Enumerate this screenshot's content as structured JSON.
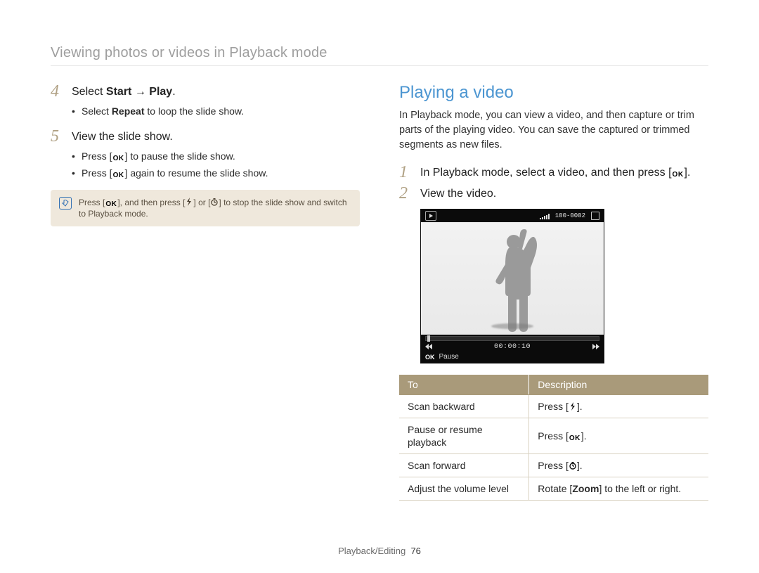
{
  "breadcrumb": "Viewing photos or videos in Playback mode",
  "page_footer": {
    "section": "Playback/Editing",
    "number": "76"
  },
  "glyphs": {
    "ok": "OK",
    "zoom": "Zoom"
  },
  "left": {
    "steps": [
      {
        "num": "4",
        "text_pre": "Select ",
        "bold1": "Start",
        "arrow": " → ",
        "bold2": "Play",
        "text_post": ".",
        "bullets": [
          {
            "pre": "Select ",
            "bold": "Repeat",
            "post": " to loop the slide show."
          }
        ]
      },
      {
        "num": "5",
        "plain": "View the slide show.",
        "bullets_ok": [
          {
            "pre": "Press [",
            "post": "] to pause the slide show."
          },
          {
            "pre": "Press [",
            "post": "] again to resume the slide show."
          }
        ]
      }
    ],
    "note": {
      "pre": "Press [",
      "mid1": "], and then press [",
      "mid2": "] or [",
      "mid3": "] to stop the slide show and switch to Playback mode."
    }
  },
  "right": {
    "title": "Playing a video",
    "intro": "In Playback mode, you can view a video, and then capture or trim parts of the playing video. You can save the captured or trimmed segments as new files.",
    "steps": [
      {
        "num": "1",
        "pre": "In Playback mode, select a video, and then press [",
        "post": "]."
      },
      {
        "num": "2",
        "plain": "View the video."
      }
    ],
    "video": {
      "file_counter": "100-0002",
      "time": "00:00:10",
      "bottom_label": "Pause"
    },
    "table": {
      "head": [
        "To",
        "Description"
      ],
      "rows": [
        {
          "to": "Scan backward",
          "desc_pre": "Press [",
          "icon": "flash",
          "desc_post": "]."
        },
        {
          "to": "Pause or resume playback",
          "desc_pre": "Press [",
          "icon": "ok",
          "desc_post": "]."
        },
        {
          "to": "Scan forward",
          "desc_pre": "Press [",
          "icon": "timer",
          "desc_post": "]."
        },
        {
          "to": "Adjust the volume level",
          "desc_pre": "Rotate [",
          "icon": "zoom",
          "desc_post": "] to the left or right."
        }
      ]
    }
  }
}
